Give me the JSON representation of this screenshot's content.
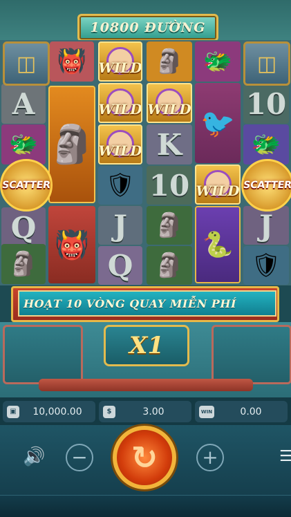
{
  "header": {
    "ways_text": "10800 ĐƯỜNG"
  },
  "reels": {
    "columns": [
      [
        "mask-red",
        "A",
        "mask-purple",
        "SCATTER",
        "Q",
        "mask-green"
      ],
      [
        "mask-red",
        "mask-gold-big",
        "mask-gold-big",
        "mask-gold-big",
        "mask-red-2",
        "mask-red-2"
      ],
      [
        "WILD",
        "WILD",
        "WILD",
        "shield-blue",
        "J",
        "Q"
      ],
      [
        "mask-gold",
        "WILD",
        "K",
        "10",
        "mask-green",
        "mask-green"
      ],
      [
        "mask-purple",
        "mask-bird",
        "mask-bird",
        "WILD",
        "serpent-purple",
        "serpent-purple"
      ],
      [
        "corner",
        "10",
        "mask-purple",
        "SCATTER",
        "J",
        "shield-blue"
      ]
    ],
    "card_labels": {
      "a": "A",
      "k": "K",
      "q": "Q",
      "j": "J",
      "ten": "10"
    },
    "wild_label": "WILD",
    "scatter_label": "SCATTER"
  },
  "message": {
    "text": "HOẠT 10 VÒNG QUAY MIỄN PHÍ"
  },
  "multiplier": {
    "text": "X1"
  },
  "stats": {
    "balance": "10,000.00",
    "bet": "3.00",
    "win": "0.00",
    "balance_icon": "wallet-icon",
    "bet_icon": "coins-icon",
    "win_icon": "win-icon",
    "win_icon_label": "WIN"
  },
  "controls": {
    "sound_icon": "speaker-icon",
    "minus_label": "−",
    "plus_label": "+",
    "spin_icon": "spin-arrow-icon",
    "menu_icon": "hamburger-icon"
  },
  "colors": {
    "accent_gold": "#e3bb4e",
    "banner_teal": "#23b2c0",
    "spin_orange": "#d23c0b"
  }
}
